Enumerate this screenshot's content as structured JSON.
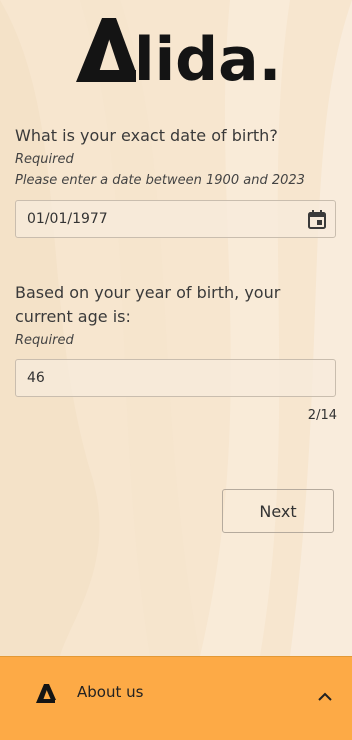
{
  "brand": {
    "name": "Alida."
  },
  "question1": {
    "label": "What is your exact date of birth?",
    "required": "Required",
    "hint": "Please enter a date between 1900 and 2023",
    "value": "01/01/1977"
  },
  "question2": {
    "label": "Based on your year of birth, your current age is:",
    "required": "Required",
    "value": "46"
  },
  "progress": {
    "counter": "2/14"
  },
  "actions": {
    "next_label": "Next"
  },
  "footer": {
    "about_label": "About us"
  },
  "colors": {
    "footer_bg": "#fdaa46",
    "page_bg": "#f7e6cf"
  },
  "icons": [
    "alida-logo",
    "calendar-icon",
    "alida-mark-icon",
    "chevron-up-icon"
  ]
}
